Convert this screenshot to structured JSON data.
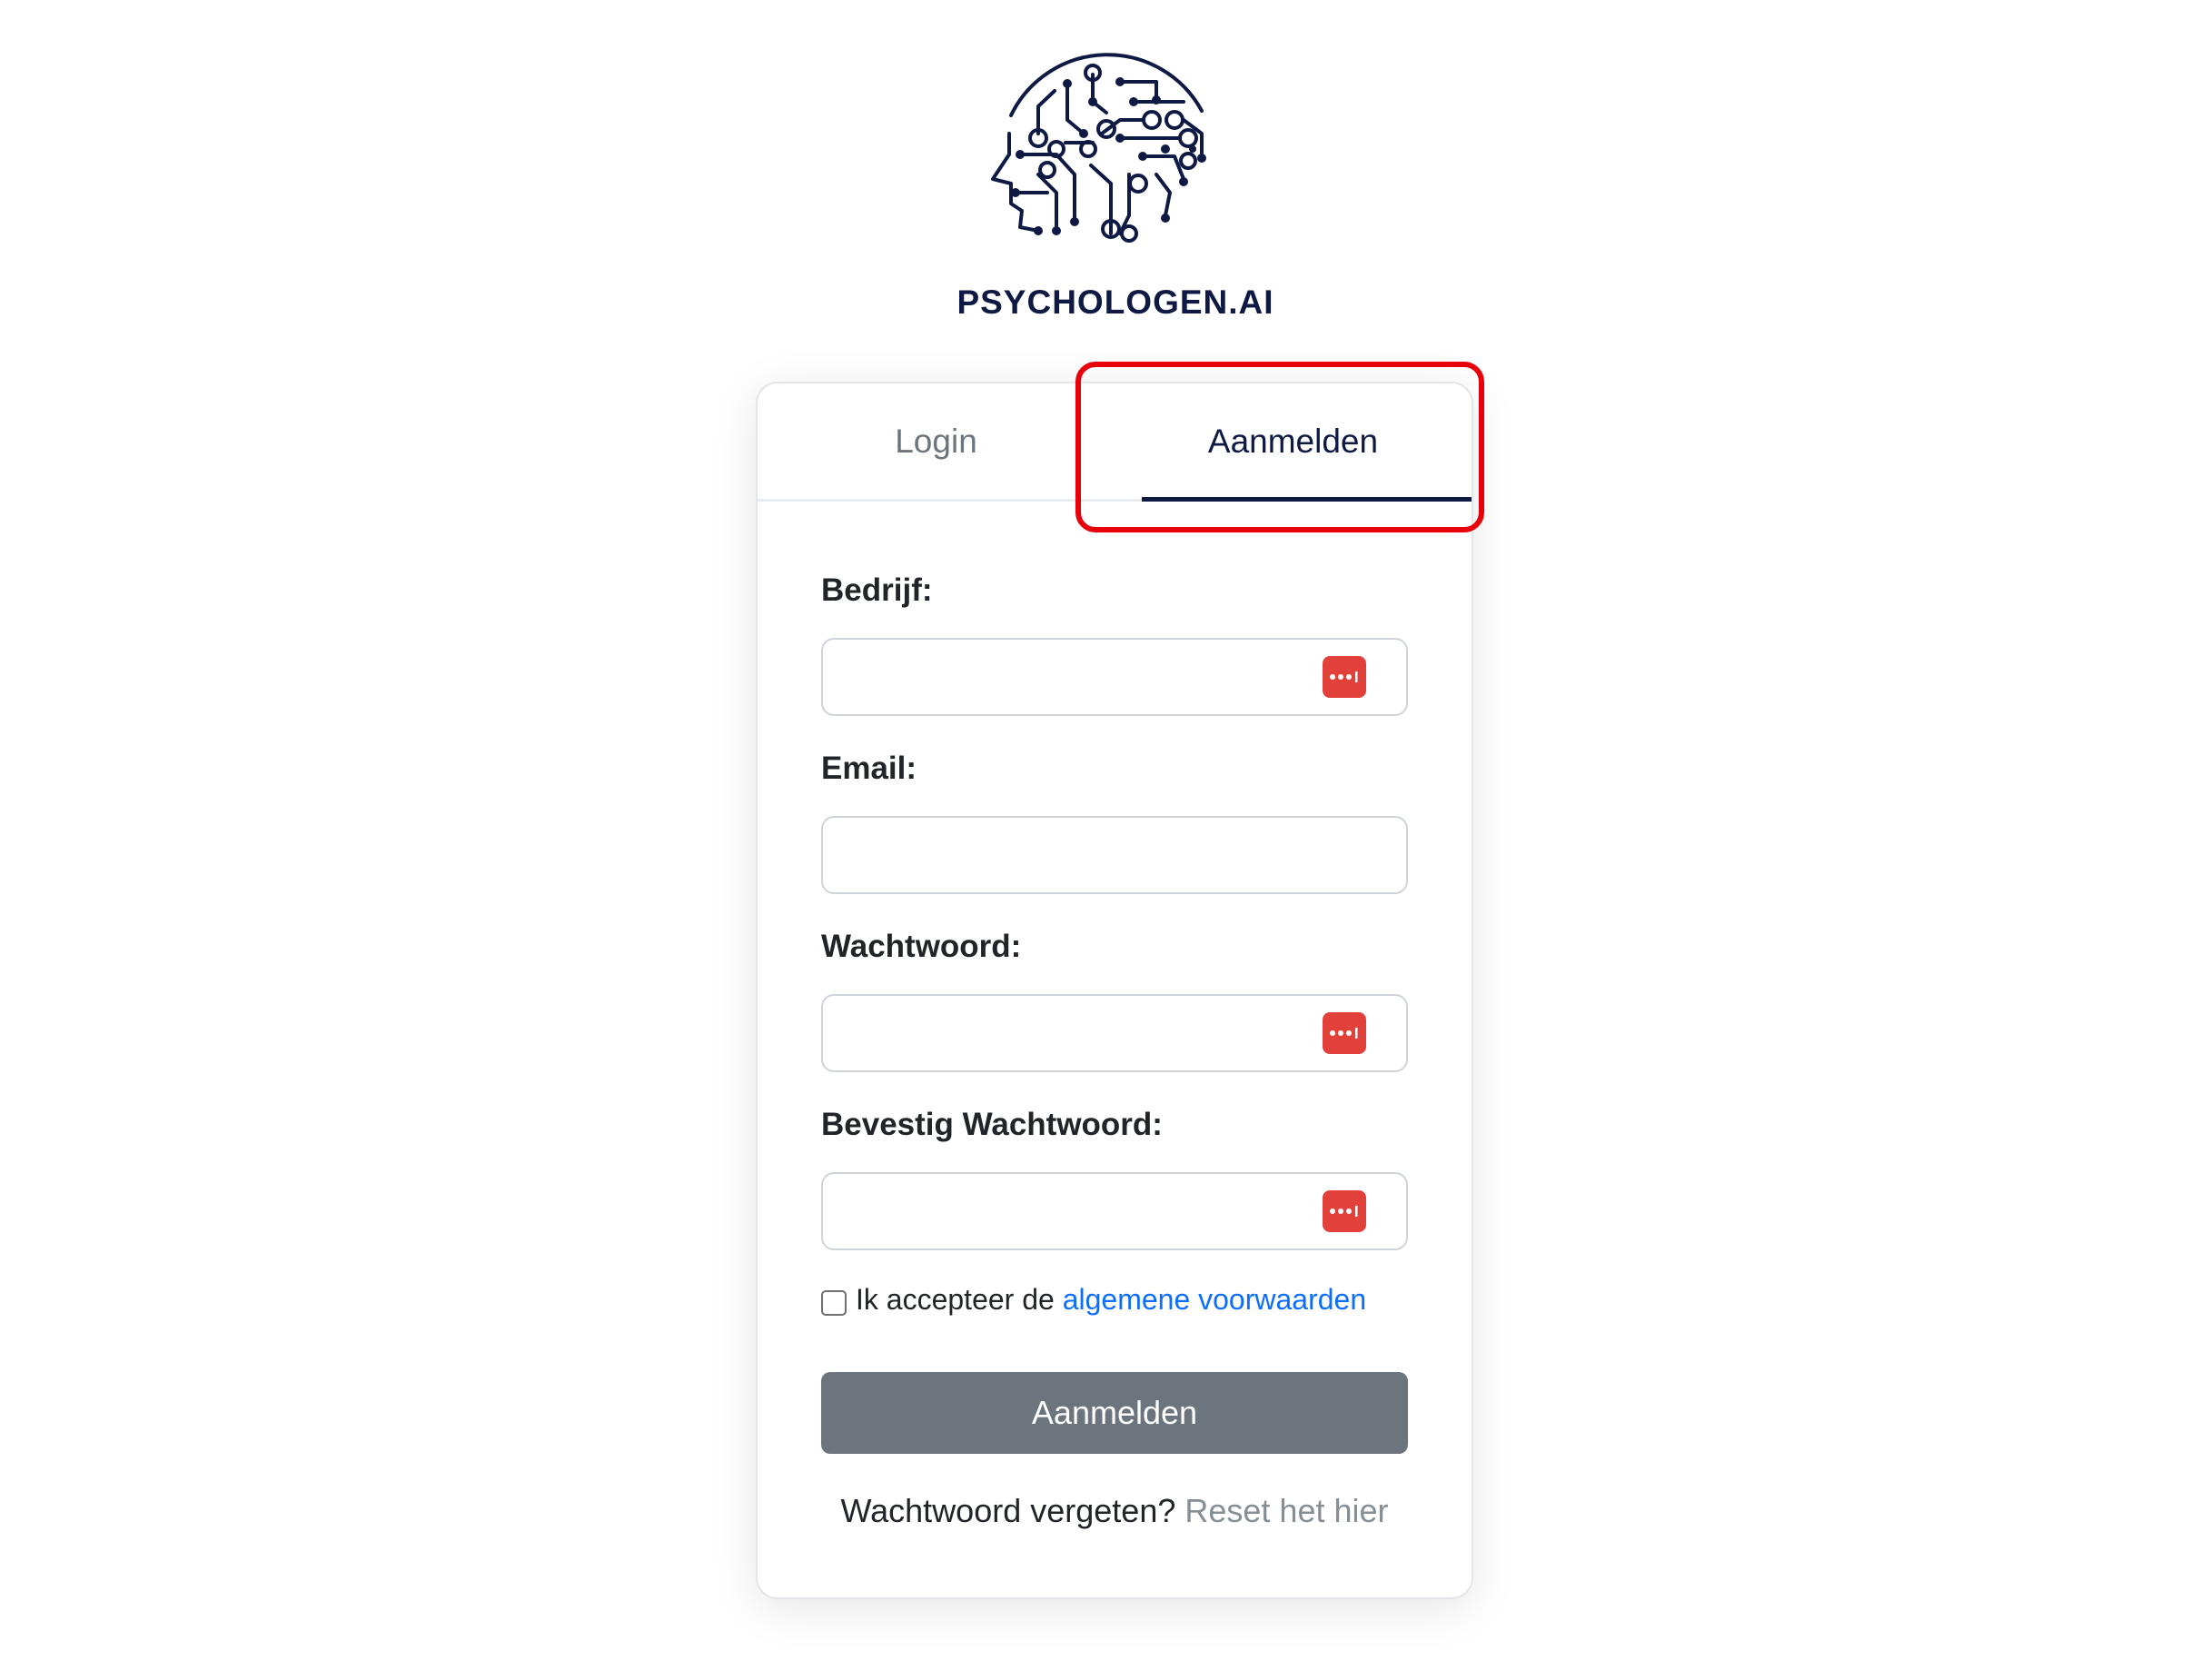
{
  "brand": {
    "name": "PSYCHOLOGEN.AI",
    "color": "#0f1a44"
  },
  "tabs": {
    "login": "Login",
    "register": "Aanmelden",
    "active": "register"
  },
  "form": {
    "company_label": "Bedrijf:",
    "email_label": "Email:",
    "password_label": "Wachtwoord:",
    "confirm_label": "Bevestig Wachtwoord:",
    "company_value": "",
    "email_value": "",
    "password_value": "",
    "confirm_value": "",
    "password_manager_icon": "password-manager-icon"
  },
  "terms": {
    "checked": false,
    "text": "Ik accepteer de",
    "link_text": "algemene voorwaarden"
  },
  "submit": {
    "label": "Aanmelden"
  },
  "forgot": {
    "text": "Wachtwoord vergeten?",
    "link_text": "Reset het hier"
  },
  "colors": {
    "accent": "#0f1a44",
    "highlight": "#e8000b",
    "button": "#6c757d",
    "link": "#0d6efd",
    "password_icon": "#e2403a"
  }
}
